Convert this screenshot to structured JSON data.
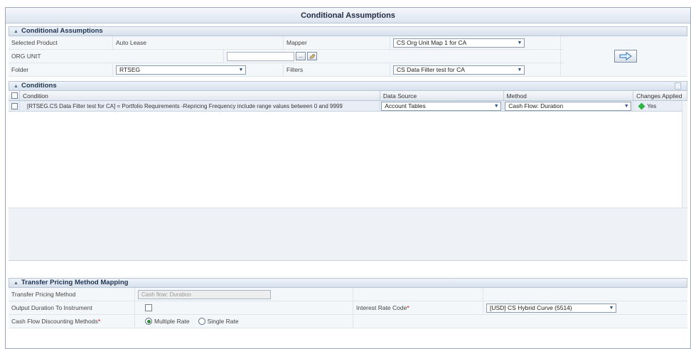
{
  "page_title": "Conditional Assumptions",
  "assumptions": {
    "section_title": "Conditional Assumptions",
    "selected_product_label": "Selected Product",
    "selected_product_value": "Auto Lease",
    "mapper_label": "Mapper",
    "mapper_value": "CS Org Unit Map 1 for CA",
    "org_unit_label": "ORG UNIT",
    "org_unit_value": "",
    "browse_label": "...",
    "folder_label": "Folder",
    "folder_value": "RTSEG",
    "filters_label": "Filters",
    "filters_value": "CS Data Filter test for CA"
  },
  "conditions": {
    "section_title": "Conditions",
    "columns": [
      "Condition",
      "Data Source",
      "Method",
      "Changes Applied"
    ],
    "rows": [
      {
        "condition": "[RTSEG.CS Data Filter test for CA] = Portfolio Requirements -Repricing Frequency include range values between 0 and 9999",
        "data_source": "Account Tables",
        "method": "Cash Flow: Duration",
        "changes_applied": "Yes"
      }
    ]
  },
  "tp_mapping": {
    "section_title": "Transfer Pricing Method Mapping",
    "method_label": "Transfer Pricing Method",
    "method_value": "Cash flow: Duration",
    "output_duration_label": "Output Duration To Instrument",
    "interest_rate_code_label": "Interest Rate Code",
    "interest_rate_code_value": "[USD] CS Hybrid Curve (5514)",
    "discount_methods_label": "Cash Flow Discounting Methods",
    "multiple_rate_label": "Multiple Rate",
    "single_rate_label": "Single Rate",
    "required_marker": "*"
  },
  "colors": {
    "header_blue": "#1f3352",
    "selected_row": "#e9eef6",
    "status_green": "#2fb143"
  },
  "icons": {
    "collapse": "chevron-up-icon",
    "go": "arrow-right-icon",
    "status": "green-diamond-icon",
    "browse": "browse-icon",
    "pencil": "edit-icon",
    "delete": "delete-icon"
  }
}
